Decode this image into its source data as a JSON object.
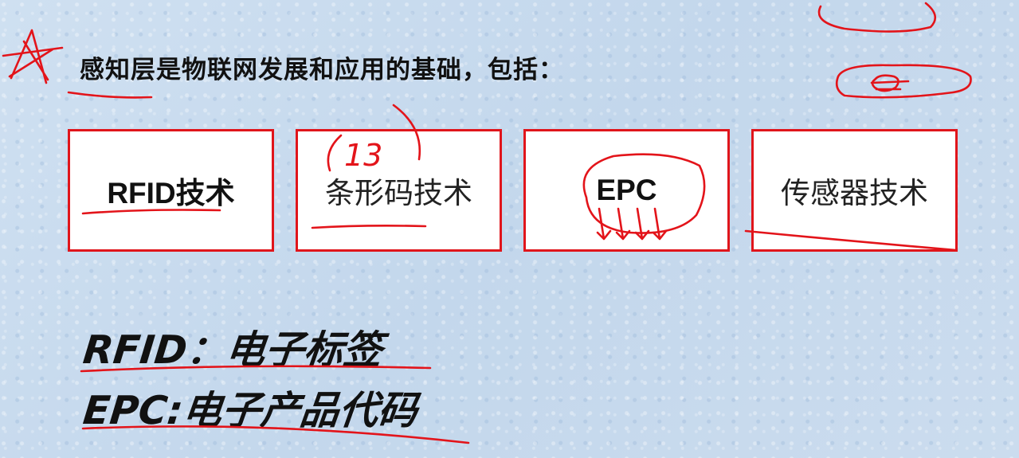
{
  "slide": {
    "heading": "感知层是物联网发展和应用的基础，包括：",
    "boxes": [
      {
        "label": "RFID技术"
      },
      {
        "label": "条形码技术"
      },
      {
        "label": "EPC"
      },
      {
        "label": "传感器技术"
      }
    ],
    "notes": [
      {
        "text": "RFID：电子标签"
      },
      {
        "text": "EPC:电子产品代码"
      }
    ]
  },
  "annotations": {
    "barcode_note": "13"
  },
  "colors": {
    "box_border": "#e0151b",
    "ink": "#e3141a",
    "background": "#c9dcef"
  }
}
